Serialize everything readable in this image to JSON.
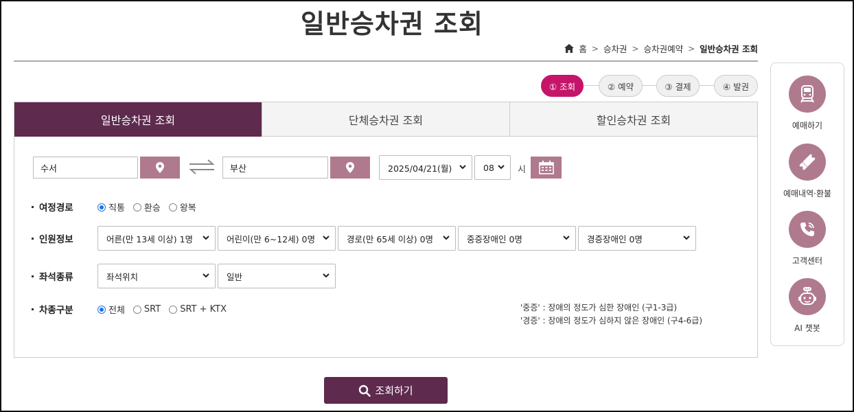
{
  "page": {
    "title": "일반승차권 조회"
  },
  "breadcrumb": {
    "home": "홈",
    "level1": "승차권",
    "level2": "승차권예약",
    "current": "일반승차권 조회"
  },
  "steps": [
    {
      "label": "① 조회",
      "active": true
    },
    {
      "label": "② 예약",
      "active": false
    },
    {
      "label": "③ 결제",
      "active": false
    },
    {
      "label": "④ 발권",
      "active": false
    }
  ],
  "tabs": [
    {
      "label": "일반승차권 조회",
      "active": true
    },
    {
      "label": "단체승차권 조회",
      "active": false
    },
    {
      "label": "할인승차권 조회",
      "active": false
    }
  ],
  "route": {
    "departure": "수서",
    "arrival": "부산",
    "date": "2025/04/21(월)",
    "hour": "08",
    "hour_unit": "시"
  },
  "trip_type": {
    "label": "여정경로",
    "options": [
      "직통",
      "환승",
      "왕복"
    ],
    "selected": "직통"
  },
  "passengers": {
    "label": "인원정보",
    "adult": "어른(만 13세 이상) 1명",
    "child": "어린이(만 6~12세) 0명",
    "senior": "경로(만 65세 이상) 0명",
    "severe_disabled": "중증장애인 0명",
    "mild_disabled": "경증장애인 0명"
  },
  "seat": {
    "label": "좌석종류",
    "position": "좌석위치",
    "class": "일반"
  },
  "train_type": {
    "label": "차종구분",
    "options": [
      "전체",
      "SRT",
      "SRT + KTX"
    ],
    "selected": "전체"
  },
  "notes": {
    "severe": "'중증' : 장애의 정도가 심한 장애인 (구1-3급)",
    "mild": "'경증' : 장애의 정도가 심하지 않은 장애인 (구4-6급)"
  },
  "search_button": "조회하기",
  "sidebar": [
    {
      "label": "예매하기",
      "icon": "train-icon"
    },
    {
      "label": "예매내역·환불",
      "icon": "ticket-icon"
    },
    {
      "label": "고객센터",
      "icon": "phone-icon"
    },
    {
      "label": "AI 챗봇",
      "icon": "robot-icon"
    }
  ],
  "colors": {
    "primary": "#5e2a4e",
    "accent": "#c6146a",
    "pin": "#b07a8e"
  }
}
